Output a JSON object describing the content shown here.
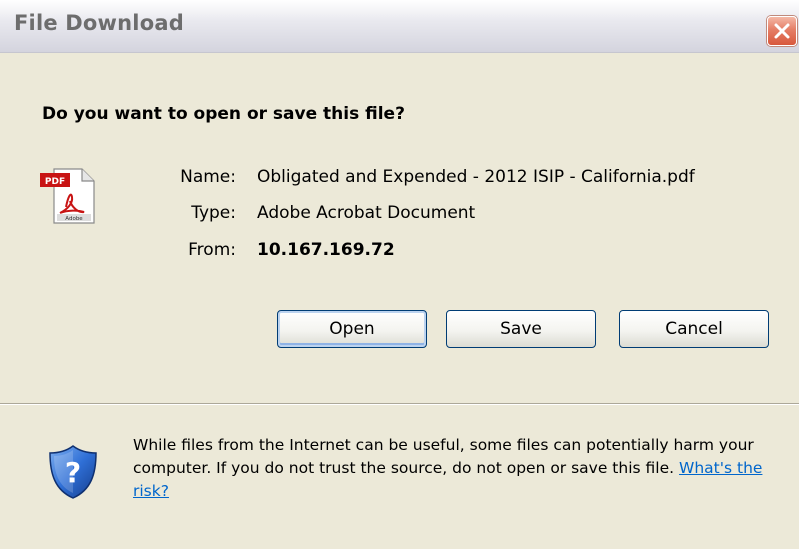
{
  "window": {
    "title": "File Download"
  },
  "dialog": {
    "question": "Do you want to open or save this file?",
    "file": {
      "icon": "pdf-file-icon",
      "name_label": "Name:",
      "name_value": "Obligated and Expended - 2012 ISIP - California.pdf",
      "type_label": "Type:",
      "type_value": "Adobe Acrobat Document",
      "from_label": "From:",
      "from_value": "10.167.169.72"
    },
    "buttons": {
      "open": "Open",
      "save": "Save",
      "cancel": "Cancel"
    },
    "warning": {
      "icon": "security-shield-question-icon",
      "text": "While files from the Internet can be useful, some files can potentially harm your computer. If you do not trust the source, do not open or save this file.",
      "link": "What's the risk?"
    }
  },
  "colors": {
    "dialog_background": "#ece9d8",
    "link": "#0066cc",
    "close_button": "#e07a5f",
    "button_border": "#003c74"
  }
}
